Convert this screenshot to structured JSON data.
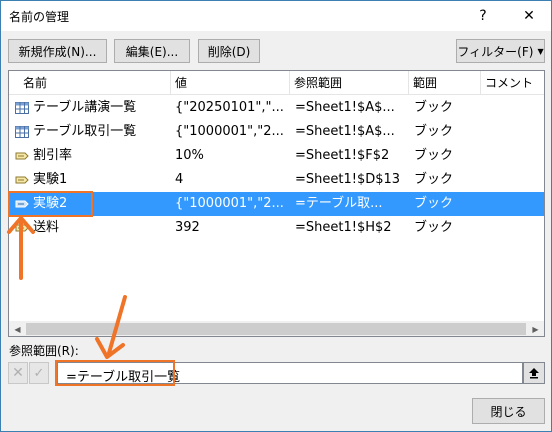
{
  "window": {
    "title": "名前の管理",
    "help_glyph": "?",
    "close_glyph": "✕"
  },
  "toolbar": {
    "new_label": "新規作成(N)...",
    "edit_label": "編集(E)...",
    "delete_label": "削除(D)",
    "filter_label": "フィルター(F)",
    "filter_arrow": "▼"
  },
  "list": {
    "columns": [
      "名前",
      "値",
      "参照範囲",
      "範囲",
      "コメント"
    ],
    "rows": [
      {
        "icon": "table-icon",
        "name": "テーブル講演一覧",
        "value": "{\"20250101\",\"...",
        "ref": "=Sheet1!$A$...",
        "scope": "ブック",
        "selected": false
      },
      {
        "icon": "table-icon",
        "name": "テーブル取引一覧",
        "value": "{\"1000001\",\"2...",
        "ref": "=Sheet1!$A$...",
        "scope": "ブック",
        "selected": false
      },
      {
        "icon": "name-tag-icon",
        "name": "割引率",
        "value": "10%",
        "ref": "=Sheet1!$F$2",
        "scope": "ブック",
        "selected": false
      },
      {
        "icon": "name-tag-icon",
        "name": "実験1",
        "value": "4",
        "ref": "=Sheet1!$D$13",
        "scope": "ブック",
        "selected": false
      },
      {
        "icon": "name-tag-icon",
        "name": "実験2",
        "value": "{\"1000001\",\"2...",
        "ref": "=テーブル取...",
        "scope": "ブック",
        "selected": true
      },
      {
        "icon": "name-tag-icon",
        "name": "送料",
        "value": "392",
        "ref": "=Sheet1!$H$2",
        "scope": "ブック",
        "selected": false
      }
    ]
  },
  "reference": {
    "label": "参照範囲(R):",
    "value": "=テーブル取引一覧"
  },
  "footer": {
    "close_label": "閉じる"
  },
  "colors": {
    "accent": "#3399ff",
    "annotation": "#f07427"
  }
}
